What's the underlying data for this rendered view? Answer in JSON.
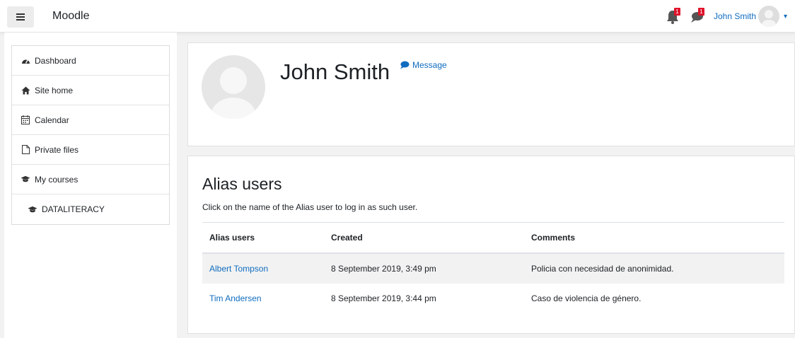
{
  "header": {
    "brand": "Moodle",
    "notifications_count": "1",
    "messages_count": "1",
    "user_name": "John Smith"
  },
  "sidebar": {
    "items": [
      {
        "label": "Dashboard",
        "icon": "dashboard-icon"
      },
      {
        "label": "Site home",
        "icon": "home-icon"
      },
      {
        "label": "Calendar",
        "icon": "calendar-icon"
      },
      {
        "label": "Private files",
        "icon": "file-icon"
      },
      {
        "label": "My courses",
        "icon": "graduation-cap-icon"
      },
      {
        "label": "DATALITERACY",
        "icon": "graduation-cap-icon"
      }
    ]
  },
  "profile": {
    "name": "John Smith",
    "message_label": "Message"
  },
  "alias": {
    "title": "Alias users",
    "description": "Click on the name of the Alias user to log in as such user.",
    "columns": [
      "Alias users",
      "Created",
      "Comments"
    ],
    "rows": [
      {
        "user": "Albert Tompson",
        "created": "8 September 2019, 3:49 pm",
        "comment": "Policia con necesidad de anonimidad."
      },
      {
        "user": "Tim Andersen",
        "created": "8 September 2019, 3:44 pm",
        "comment": "Caso de violencia de género."
      }
    ]
  },
  "colors": {
    "link": "#0f6cbf",
    "badge": "#e0132a",
    "page_background": "#f2f2f2"
  }
}
